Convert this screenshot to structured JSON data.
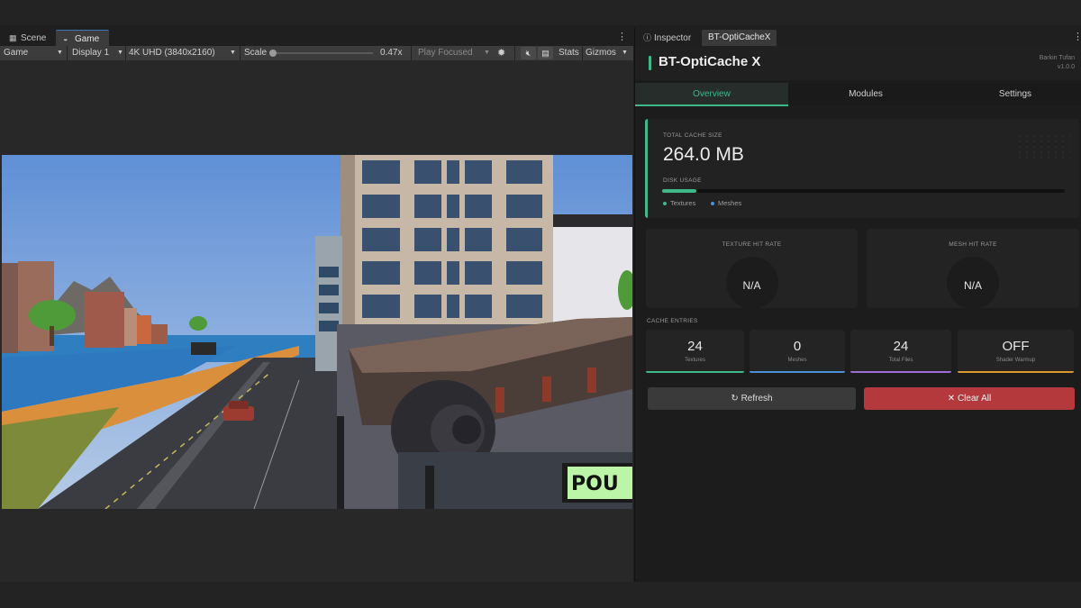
{
  "editor": {
    "tabs": [
      {
        "label": "Scene",
        "icon": "grid-icon"
      },
      {
        "label": "Game",
        "icon": "gamepad-icon"
      }
    ],
    "menu_icon": "⋮",
    "toolbar": {
      "display_mode": "Game",
      "display": "Display 1",
      "resolution": "4K UHD (3840x2160)",
      "scale_label": "Scale",
      "scale_value": "0.47x",
      "play_mode": "Play Focused",
      "stats": "Stats",
      "gizmos": "Gizmos"
    },
    "viewport_sign": "POU"
  },
  "inspector": {
    "tabs": [
      {
        "label": "Inspector",
        "icon": "info-icon"
      },
      {
        "label": "BT-OptiCacheX"
      }
    ],
    "plugin": {
      "title": "BT-OptiCache X",
      "author": "Barkin Tufan",
      "version": "v1.0.0"
    },
    "nav": [
      "Overview",
      "Modules",
      "Settings"
    ],
    "cache": {
      "label": "TOTAL CACHE SIZE",
      "size": "264.0 MB",
      "disk_label": "DISK USAGE",
      "disk_usage_fraction": 0.085,
      "legend": [
        {
          "label": "Textures",
          "color": "#3fb88a"
        },
        {
          "label": "Meshes",
          "color": "#4a90d9"
        }
      ]
    },
    "hit_rates": [
      {
        "label": "TEXTURE HIT RATE",
        "value": "N/A"
      },
      {
        "label": "MESH HIT RATE",
        "value": "N/A"
      }
    ],
    "entries_label": "CACHE ENTRIES",
    "entries": [
      {
        "value": "24",
        "label": "Textures",
        "color": "#3fb88a"
      },
      {
        "value": "0",
        "label": "Meshes",
        "color": "#4a90d9"
      },
      {
        "value": "24",
        "label": "Total Files",
        "color": "#9b6bd6"
      },
      {
        "value": "OFF",
        "label": "Shader Warmup",
        "color": "#d99a2b"
      }
    ],
    "buttons": {
      "refresh": "↻ Refresh",
      "clear": "✕ Clear All"
    }
  }
}
